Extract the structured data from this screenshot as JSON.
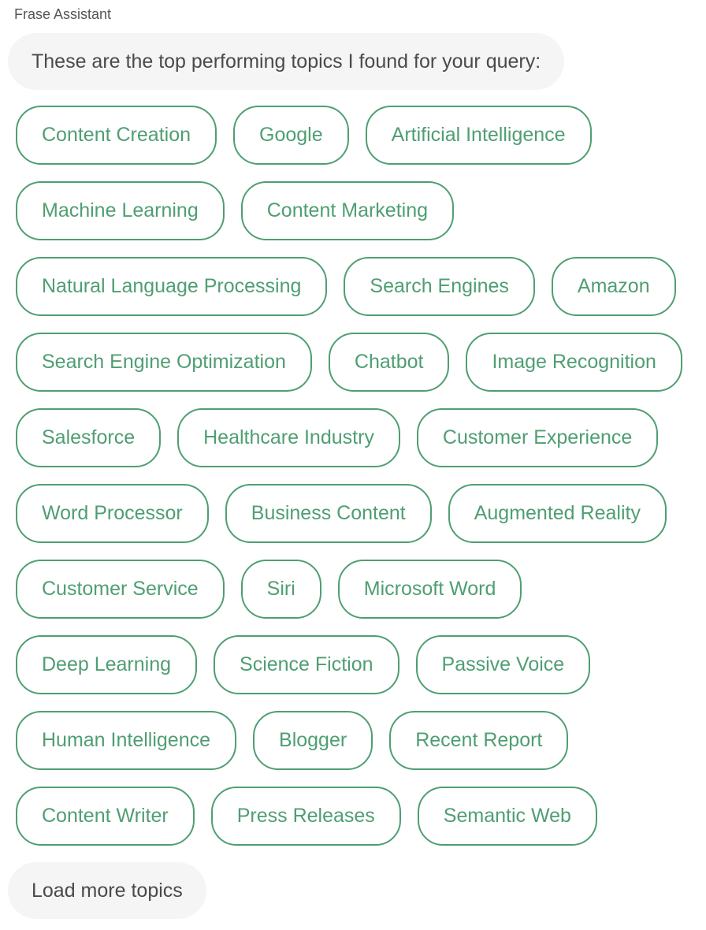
{
  "sender": "Frase Assistant",
  "message": "These are the top performing topics I found for your query:",
  "colors": {
    "accent": "#4f9e72",
    "bubble_bg": "#f5f5f5",
    "text": "#4a4a4a"
  },
  "topics": [
    "Content Creation",
    "Google",
    "Artificial Intelligence",
    "Machine Learning",
    "Content Marketing",
    "Natural Language Processing",
    "Search Engines",
    "Amazon",
    "Search Engine Optimization",
    "Chatbot",
    "Image Recognition",
    "Salesforce",
    "Healthcare Industry",
    "Customer Experience",
    "Word Processor",
    "Business Content",
    "Augmented Reality",
    "Customer Service",
    "Siri",
    "Microsoft Word",
    "Deep Learning",
    "Science Fiction",
    "Passive Voice",
    "Human Intelligence",
    "Blogger",
    "Recent Report",
    "Content Writer",
    "Press Releases",
    "Semantic Web"
  ],
  "load_more_label": "Load more topics"
}
